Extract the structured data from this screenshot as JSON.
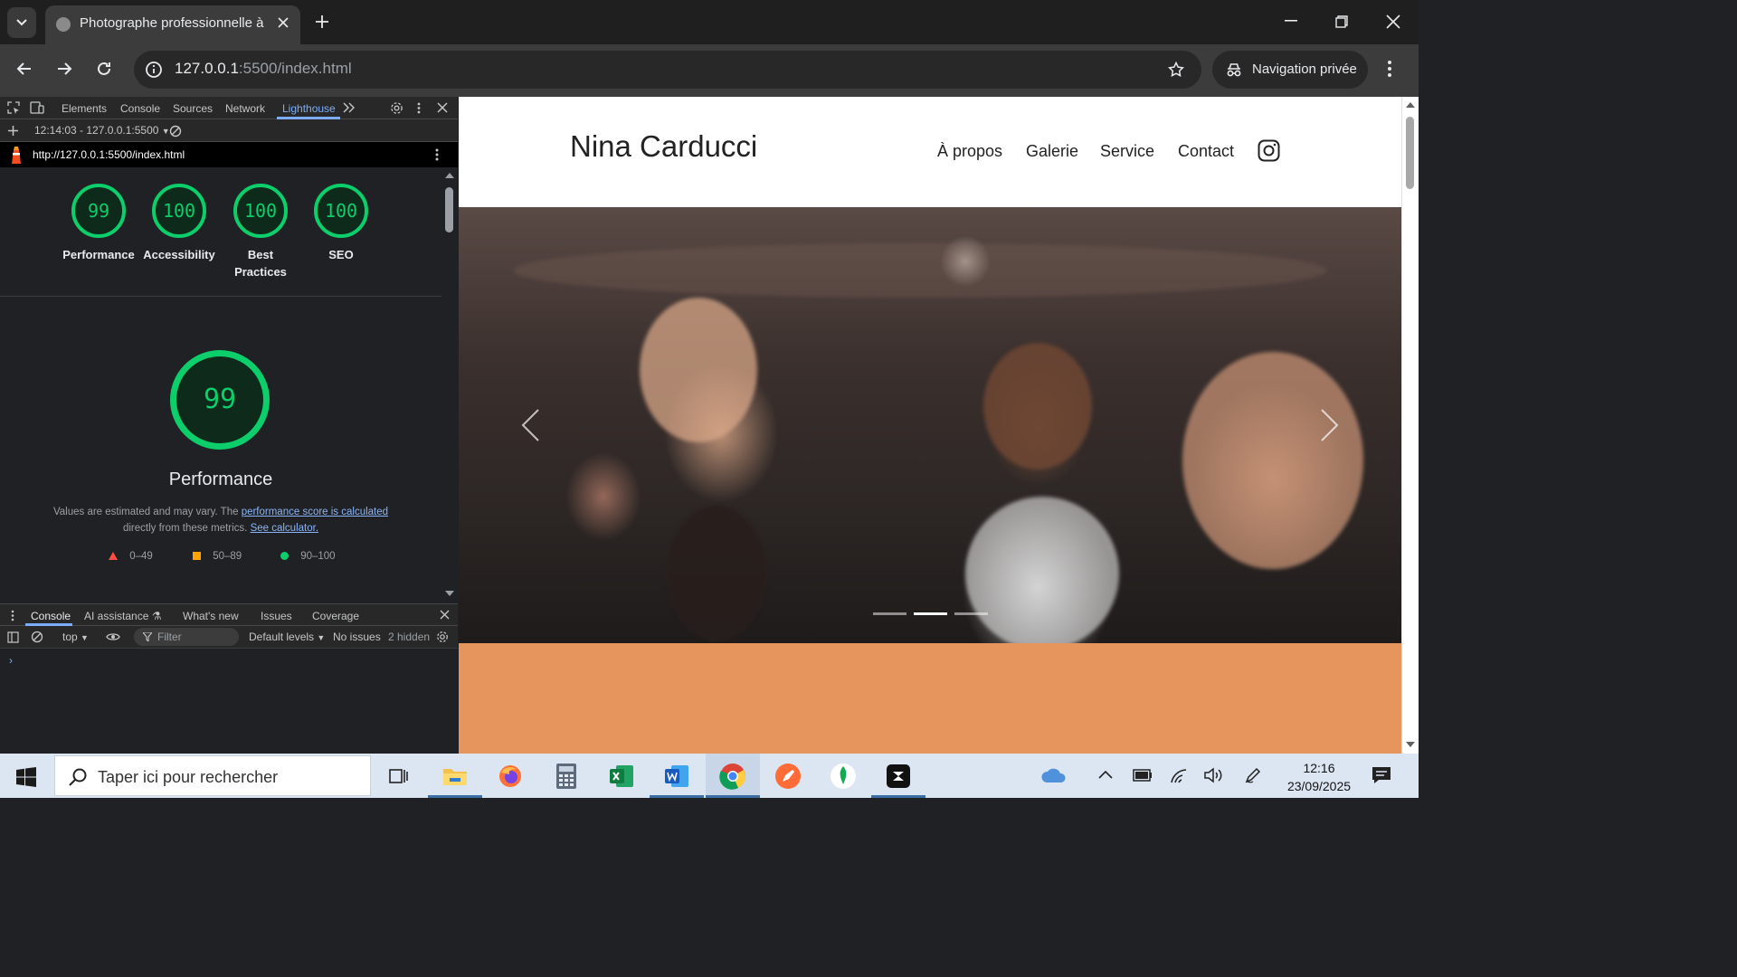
{
  "browser": {
    "tab_title": "Photographe professionnelle à",
    "url": "127.0.0.1:5500/index.html",
    "url_host": "127.0.0.1",
    "url_rest": ":5500/index.html",
    "private_label": "Navigation privée"
  },
  "devtools": {
    "tabs": [
      "Elements",
      "Console",
      "Sources",
      "Network",
      "Lighthouse"
    ],
    "active_tab": "Lighthouse",
    "run_selector": "12:14:03 - 127.0.0.1:5500",
    "report_url": "http://127.0.0.1:5500/index.html",
    "scores": [
      {
        "label": "Performance",
        "value": "99"
      },
      {
        "label": "Accessibility",
        "value": "100"
      },
      {
        "label": "Best",
        "label2": "Practices",
        "value": "100"
      },
      {
        "label": "SEO",
        "value": "100"
      }
    ],
    "perf": {
      "score": "99",
      "title": "Performance",
      "note_1": "Values are estimated and may vary. The ",
      "note_link_1": "performance score is calculated",
      "note_2": "directly from these metrics. ",
      "note_link_2": "See calculator."
    },
    "legend": [
      {
        "range": "0–49",
        "color": "#ff4e42",
        "shape": "triangle"
      },
      {
        "range": "50–89",
        "color": "#ffa400",
        "shape": "square"
      },
      {
        "range": "90–100",
        "color": "#0cce6b",
        "shape": "circle"
      }
    ],
    "drawer_tabs": [
      "Console",
      "AI assistance",
      "What's new",
      "Issues",
      "Coverage"
    ],
    "console_bar": {
      "context": "top",
      "filter_placeholder": "Filter",
      "levels": "Default levels",
      "issues": "No issues",
      "hidden": "2 hidden"
    },
    "prompt": "›"
  },
  "site": {
    "title": "Nina Carducci",
    "nav": [
      "À propos",
      "Galerie",
      "Service",
      "Contact"
    ],
    "carousel": {
      "slides": 3,
      "active": 2
    },
    "accent_color": "#e6955d"
  },
  "taskbar": {
    "search_placeholder": "Taper ici pour rechercher",
    "time": "12:16",
    "date": "23/09/2025"
  }
}
